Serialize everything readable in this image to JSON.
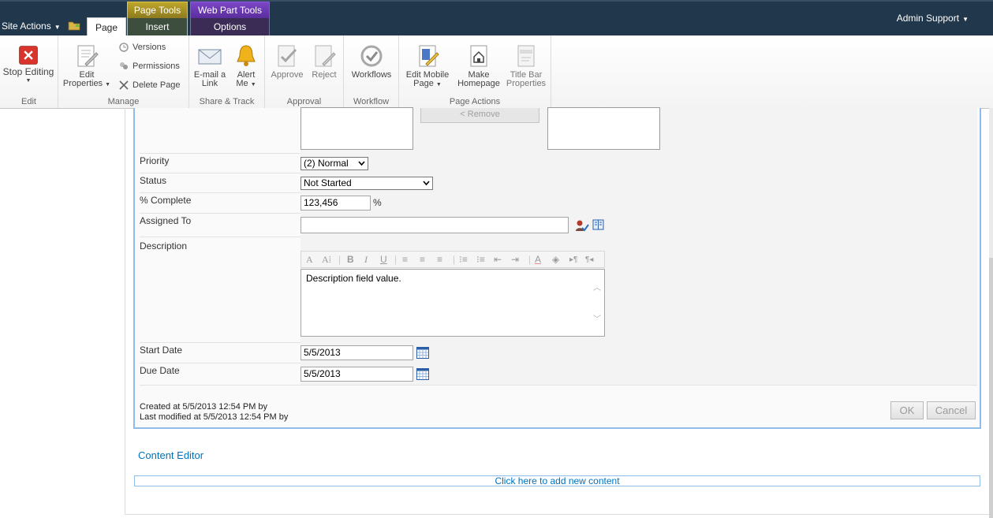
{
  "topbar": {
    "site_actions": "Site Actions",
    "tab_page": "Page",
    "page_tools": {
      "title": "Page Tools",
      "tab": "Insert"
    },
    "web_part_tools": {
      "title": "Web Part Tools",
      "tab": "Options"
    },
    "user": "Admin Support"
  },
  "ribbon": {
    "edit": {
      "label": "Edit",
      "stop_editing": "Stop Editing"
    },
    "manage": {
      "label": "Manage",
      "edit_properties_line1": "Edit",
      "edit_properties_line2": "Properties",
      "versions": "Versions",
      "permissions": "Permissions",
      "delete_page": "Delete Page"
    },
    "share_track": {
      "label": "Share & Track",
      "email_line1": "E-mail a",
      "email_line2": "Link",
      "alert_line1": "Alert",
      "alert_line2": "Me"
    },
    "approval": {
      "label": "Approval",
      "approve": "Approve",
      "reject": "Reject"
    },
    "workflow": {
      "label": "Workflow",
      "workflows": "Workflows"
    },
    "page_actions": {
      "label": "Page Actions",
      "edit_mobile_line1": "Edit Mobile",
      "edit_mobile_line2": "Page",
      "make_home_line1": "Make",
      "make_home_line2": "Homepage",
      "title_bar_line1": "Title Bar",
      "title_bar_line2": "Properties"
    }
  },
  "form": {
    "remove_button": "< Remove",
    "priority": {
      "label": "Priority",
      "value": "(2) Normal"
    },
    "status": {
      "label": "Status",
      "value": "Not Started"
    },
    "percent_complete": {
      "label": "% Complete",
      "value": "123,456",
      "suffix": "%"
    },
    "assigned_to": {
      "label": "Assigned To",
      "value": ""
    },
    "description": {
      "label": "Description",
      "value": "Description field value."
    },
    "start_date": {
      "label": "Start Date",
      "value": "5/5/2013"
    },
    "due_date": {
      "label": "Due Date",
      "value": "5/5/2013"
    },
    "created": "Created at 5/5/2013 12:54 PM by",
    "modified": "Last modified at 5/5/2013 12:54 PM by",
    "ok": "OK",
    "cancel": "Cancel"
  },
  "content_editor": {
    "title": "Content Editor",
    "add_link": "Click here to add new content"
  }
}
